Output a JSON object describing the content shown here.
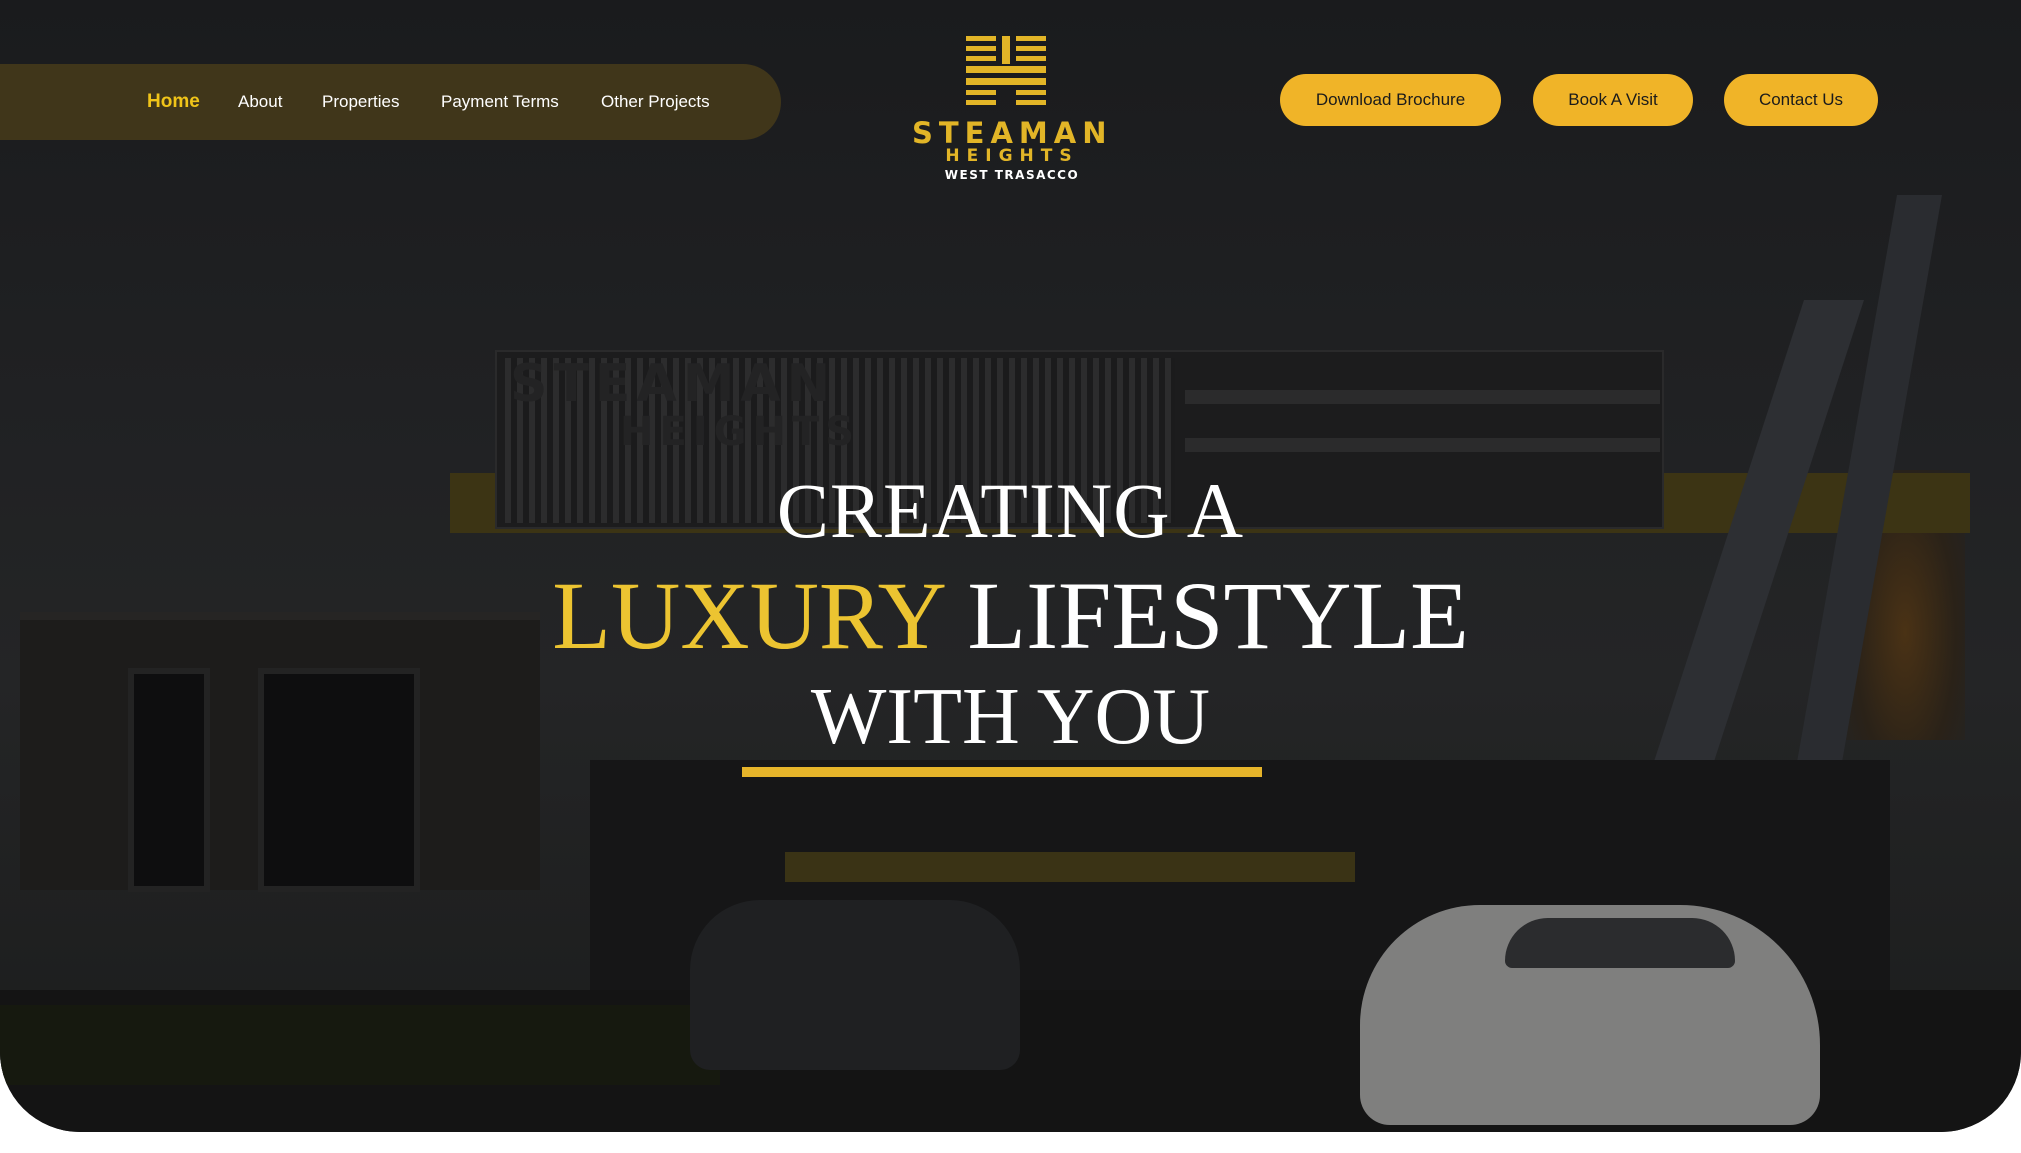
{
  "nav": {
    "items": [
      {
        "label": "Home",
        "active": true
      },
      {
        "label": "About",
        "active": false
      },
      {
        "label": "Properties",
        "active": false
      },
      {
        "label": "Payment Terms",
        "active": false
      },
      {
        "label": "Other Projects",
        "active": false
      }
    ]
  },
  "logo": {
    "name": "STEAMAN",
    "sub": "HEIGHTS",
    "location": "WEST TRASACCO"
  },
  "actions": {
    "download_brochure": "Download Brochure",
    "book_visit": "Book A Visit",
    "contact_us": "Contact Us"
  },
  "hero": {
    "line1": "CREATING A",
    "line2_highlight": "LUXURY",
    "line2_rest": "LIFESTYLE",
    "line3": "WITH YOU"
  },
  "colors": {
    "accent": "#f0b428",
    "nav_active": "#f0c419",
    "highlight_text": "#ecc431",
    "nav_pill": "#40361a",
    "background": "#1f2022"
  }
}
